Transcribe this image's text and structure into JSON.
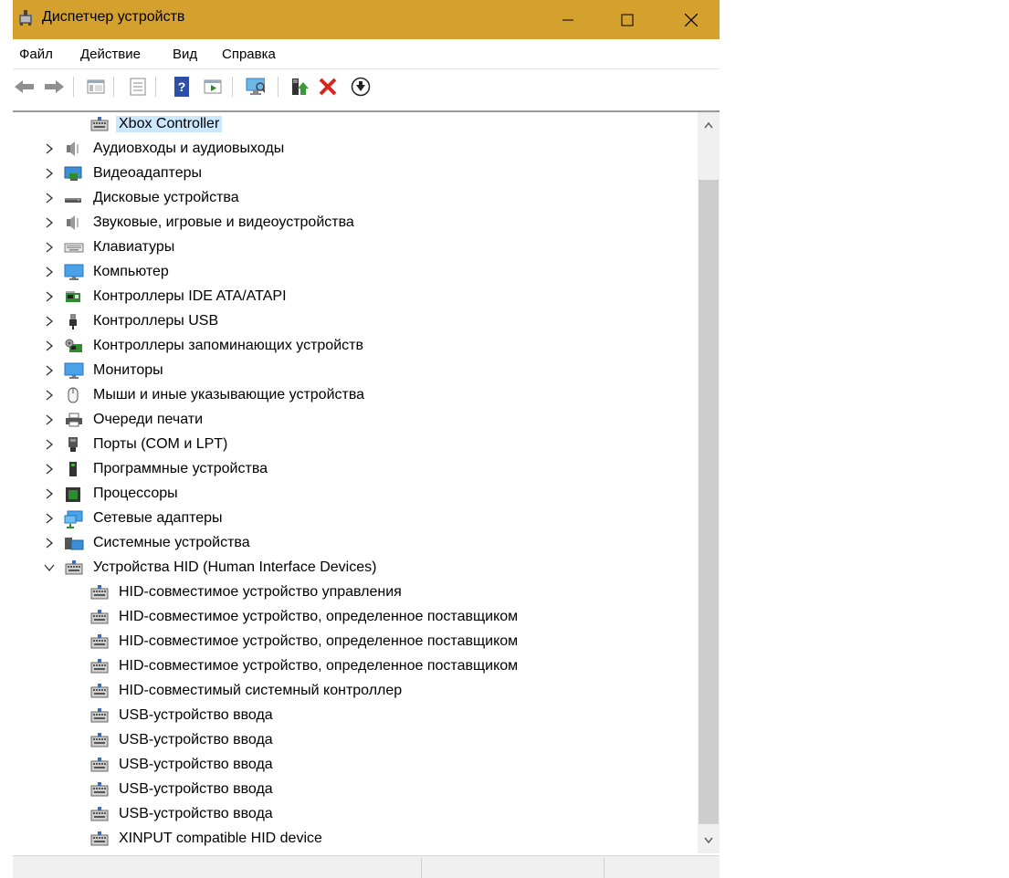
{
  "window": {
    "title": "Диспетчер устройств",
    "title_bar_color": "#d4a12f",
    "controls": [
      "minimize",
      "maximize",
      "close"
    ]
  },
  "menu": [
    "Файл",
    "Действие",
    "Вид",
    "Справка"
  ],
  "toolbar": [
    {
      "icon": "back-arrow-icon"
    },
    {
      "icon": "forward-arrow-icon"
    },
    {
      "icon": "show-hide-console-tree-icon"
    },
    {
      "icon": "properties-icon"
    },
    {
      "icon": "help-icon"
    },
    {
      "icon": "run-icon"
    },
    {
      "icon": "scan-hardware-icon"
    },
    {
      "icon": "update-driver-icon"
    },
    {
      "icon": "uninstall-device-icon"
    },
    {
      "icon": "disable-device-icon"
    }
  ],
  "tree": {
    "top_child": {
      "label": "Xbox Controller",
      "icon": "hid-device-icon",
      "selected": true
    },
    "categories": [
      {
        "label": "Аудиовходы и аудиовыходы",
        "icon": "speaker-icon",
        "expanded": false
      },
      {
        "label": "Видеоадаптеры",
        "icon": "display-adapter-icon",
        "expanded": false
      },
      {
        "label": "Дисковые устройства",
        "icon": "disk-drive-icon",
        "expanded": false
      },
      {
        "label": "Звуковые, игровые и видеоустройства",
        "icon": "speaker-icon",
        "expanded": false
      },
      {
        "label": "Клавиатуры",
        "icon": "keyboard-icon",
        "expanded": false
      },
      {
        "label": "Компьютер",
        "icon": "monitor-icon",
        "expanded": false
      },
      {
        "label": "Контроллеры IDE ATA/ATAPI",
        "icon": "ide-controller-icon",
        "expanded": false
      },
      {
        "label": "Контроллеры USB",
        "icon": "usb-plug-icon",
        "expanded": false
      },
      {
        "label": "Контроллеры запоминающих устройств",
        "icon": "storage-controller-icon",
        "expanded": false
      },
      {
        "label": "Мониторы",
        "icon": "monitor-icon",
        "expanded": false
      },
      {
        "label": "Мыши и иные указывающие устройства",
        "icon": "mouse-icon",
        "expanded": false
      },
      {
        "label": "Очереди печати",
        "icon": "printer-icon",
        "expanded": false
      },
      {
        "label": "Порты (COM и LPT)",
        "icon": "port-icon",
        "expanded": false
      },
      {
        "label": "Программные устройства",
        "icon": "software-device-icon",
        "expanded": false
      },
      {
        "label": "Процессоры",
        "icon": "processor-icon",
        "expanded": false
      },
      {
        "label": "Сетевые адаптеры",
        "icon": "network-adapter-icon",
        "expanded": false
      },
      {
        "label": "Системные устройства",
        "icon": "system-device-icon",
        "expanded": false
      },
      {
        "label": "Устройства HID (Human Interface Devices)",
        "icon": "hid-device-icon",
        "expanded": true
      }
    ],
    "hid_children": [
      "HID-совместимое устройство управления",
      "HID-совместимое устройство, определенное поставщиком",
      "HID-совместимое устройство, определенное поставщиком",
      "HID-совместимое устройство, определенное поставщиком",
      "HID-совместимый системный контроллер",
      "USB-устройство ввода",
      "USB-устройство ввода",
      "USB-устройство ввода",
      "USB-устройство ввода",
      "USB-устройство ввода",
      "XINPUT compatible HID device"
    ]
  },
  "selection_color": "#cce8ff"
}
